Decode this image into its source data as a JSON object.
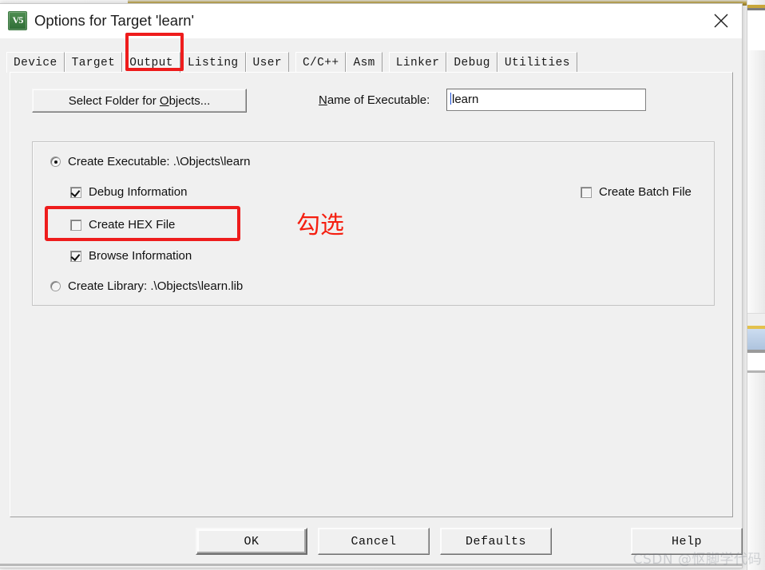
{
  "window": {
    "title": "Options for Target 'learn'",
    "icon": "keil-uvision5-icon",
    "icon_text": "V5",
    "close_label": "×"
  },
  "tabs": [
    {
      "label": "Device",
      "active": false
    },
    {
      "label": "Target",
      "active": false
    },
    {
      "label": "Output",
      "active": true
    },
    {
      "label": "Listing",
      "active": false
    },
    {
      "label": "User",
      "active": false
    },
    {
      "label": "C/C++",
      "active": false
    },
    {
      "label": "Asm",
      "active": false
    },
    {
      "label": "Linker",
      "active": false
    },
    {
      "label": "Debug",
      "active": false
    },
    {
      "label": "Utilities",
      "active": false
    }
  ],
  "output_page": {
    "select_folder_button": "Select Folder for Objects...",
    "name_of_executable_label": "Name of Executable:",
    "name_of_executable_value": "learn",
    "name_of_executable_placeholder": "",
    "options": {
      "create_executable": {
        "label": "Create Executable:  .\\Objects\\learn",
        "selected": true
      },
      "debug_information": {
        "label": "Debug Information",
        "checked": true
      },
      "create_hex_file": {
        "label": "Create HEX File",
        "checked": false
      },
      "browse_information": {
        "label": "Browse Information",
        "checked": true
      },
      "create_library": {
        "label": "Create Library:  .\\Objects\\learn.lib",
        "selected": false
      },
      "create_batch_file": {
        "label": "Create Batch File",
        "checked": false
      }
    }
  },
  "annotations": {
    "color": "#ee1c1c",
    "hex_note": "勾选",
    "tab_box_target": "Output",
    "checkbox_box_target": "Create HEX File"
  },
  "buttons": {
    "ok": "OK",
    "cancel": "Cancel",
    "defaults": "Defaults",
    "help": "Help"
  },
  "watermark": "CSDN @怄脚学代码"
}
